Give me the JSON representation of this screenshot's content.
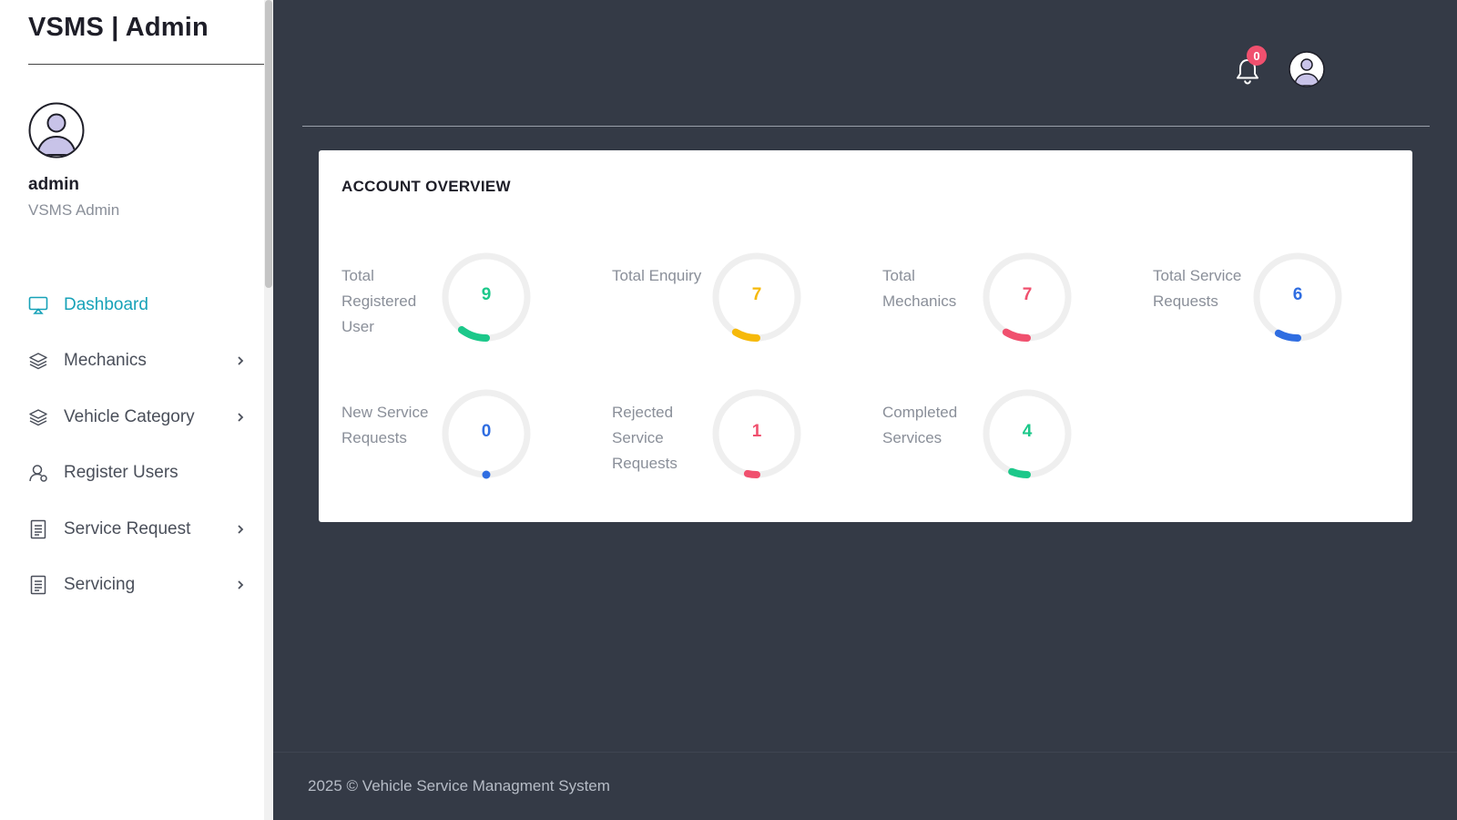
{
  "sidebar": {
    "brand": "VSMS | Admin",
    "user_name": "admin",
    "user_role": "VSMS Admin",
    "items": [
      {
        "label": "Dashboard",
        "icon": "monitor-icon",
        "active": true,
        "chevron": false
      },
      {
        "label": "Mechanics",
        "icon": "layers-icon",
        "active": false,
        "chevron": true
      },
      {
        "label": "Vehicle Category",
        "icon": "layers-icon",
        "active": false,
        "chevron": true
      },
      {
        "label": "Register Users",
        "icon": "user-icon",
        "active": false,
        "chevron": false
      },
      {
        "label": "Service Request",
        "icon": "document-icon",
        "active": false,
        "chevron": true
      },
      {
        "label": "Servicing",
        "icon": "document-icon",
        "active": false,
        "chevron": true
      }
    ]
  },
  "header": {
    "notification_count": "0"
  },
  "overview": {
    "title": "ACCOUNT OVERVIEW",
    "stats": [
      {
        "label": "Total Registered User",
        "value": "9",
        "color": "#1cc88a"
      },
      {
        "label": "Total Enquiry",
        "value": "7",
        "color": "#f6b90a"
      },
      {
        "label": "Total Mechanics",
        "value": "7",
        "color": "#f0506e"
      },
      {
        "label": "Total Service Requests",
        "value": "6",
        "color": "#2f6de1"
      },
      {
        "label": "New Service Requests",
        "value": "0",
        "color": "#2f6de1"
      },
      {
        "label": "Rejected Service Requests",
        "value": "1",
        "color": "#f0506e"
      },
      {
        "label": "Completed Services",
        "value": "4",
        "color": "#1cc88a"
      }
    ]
  },
  "footer": {
    "text": "2025 © Vehicle Service Managment System"
  },
  "colors": {
    "accent": "#17a2b8",
    "background": "#343a46",
    "badge": "#f0506e"
  }
}
